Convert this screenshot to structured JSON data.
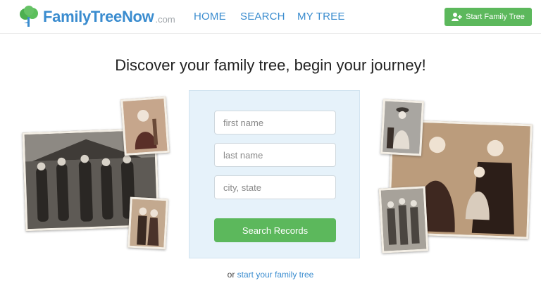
{
  "header": {
    "logo_name": "FamilyTreeNow",
    "logo_suffix": ".com",
    "nav": [
      "HOME",
      "SEARCH",
      "MY TREE"
    ],
    "start_button": "Start Family Tree"
  },
  "main": {
    "headline": "Discover your family tree, begin your journey!",
    "search": {
      "first_name_placeholder": "first name",
      "last_name_placeholder": "last name",
      "city_state_placeholder": "city, state",
      "submit": "Search Records"
    },
    "footer_prefix": "or",
    "footer_link": "start your family tree"
  },
  "colors": {
    "brand_blue": "#3a8ccf",
    "green": "#5cb85c",
    "panel": "#e6f2fa"
  }
}
